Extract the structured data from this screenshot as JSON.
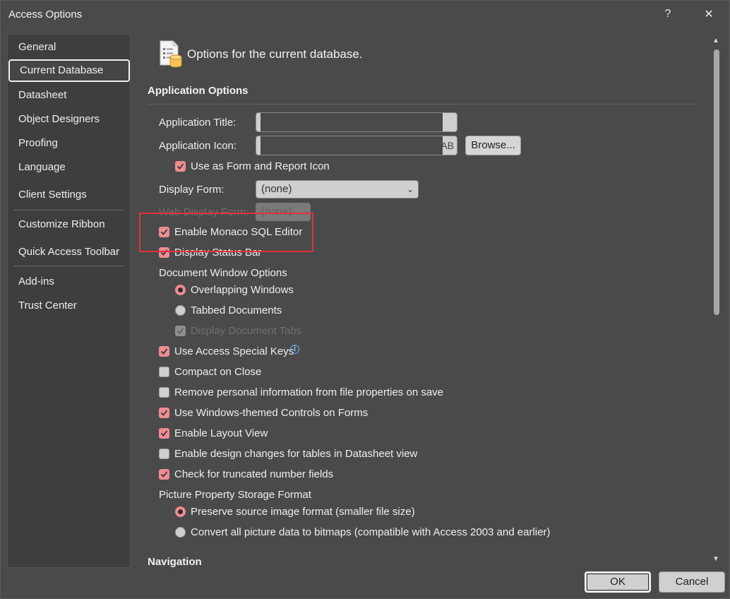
{
  "window": {
    "title": "Access Options",
    "help": "?",
    "close": "✕"
  },
  "nav": {
    "items": [
      {
        "label": "General"
      },
      {
        "label": "Current Database"
      },
      {
        "label": "Datasheet"
      },
      {
        "label": "Object Designers"
      },
      {
        "label": "Proofing"
      },
      {
        "label": "Language"
      },
      {
        "label": "Client Settings"
      },
      {
        "label": "Customize Ribbon"
      },
      {
        "label": "Quick Access Toolbar"
      },
      {
        "label": "Add-ins"
      },
      {
        "label": "Trust Center"
      }
    ]
  },
  "header": {
    "title": "Options for the current database."
  },
  "app_options": {
    "heading": "Application Options",
    "app_title_label": "Application Title:",
    "app_icon_label": "Application Icon:",
    "app_icon_value_fragment": "AB",
    "browse_label": "Browse...",
    "use_as_icon_label": "Use as Form and Report Icon",
    "display_form_label": "Display Form:",
    "display_form_value": "(none)",
    "web_display_form_label": "Web Display Form:",
    "web_display_form_value": "(none)",
    "monaco_label": "Enable Monaco SQL Editor",
    "status_bar_label": "Display Status Bar",
    "doc_window_label": "Document Window Options",
    "overlapping_label": "Overlapping Windows",
    "tabbed_label": "Tabbed Documents",
    "display_tabs_label": "Display Document Tabs",
    "special_keys_label": "Use Access Special Keys",
    "compact_label": "Compact on Close",
    "remove_personal_label": "Remove personal information from file properties on save",
    "windows_themed_label": "Use Windows-themed Controls on Forms",
    "layout_view_label": "Enable Layout View",
    "design_changes_label": "Enable design changes for tables in Datasheet view",
    "truncated_label": "Check for truncated number fields",
    "picture_storage_label": "Picture Property Storage Format",
    "preserve_label": "Preserve source image format (smaller file size)",
    "convert_label": "Convert all picture data to bitmaps (compatible with Access 2003 and earlier)"
  },
  "navigation": {
    "heading": "Navigation"
  },
  "footer": {
    "ok_label": "OK",
    "cancel_label": "Cancel"
  },
  "colors": {
    "accent": "#ee8c92",
    "highlight": "#e0333e",
    "background": "#4a4a4a"
  }
}
